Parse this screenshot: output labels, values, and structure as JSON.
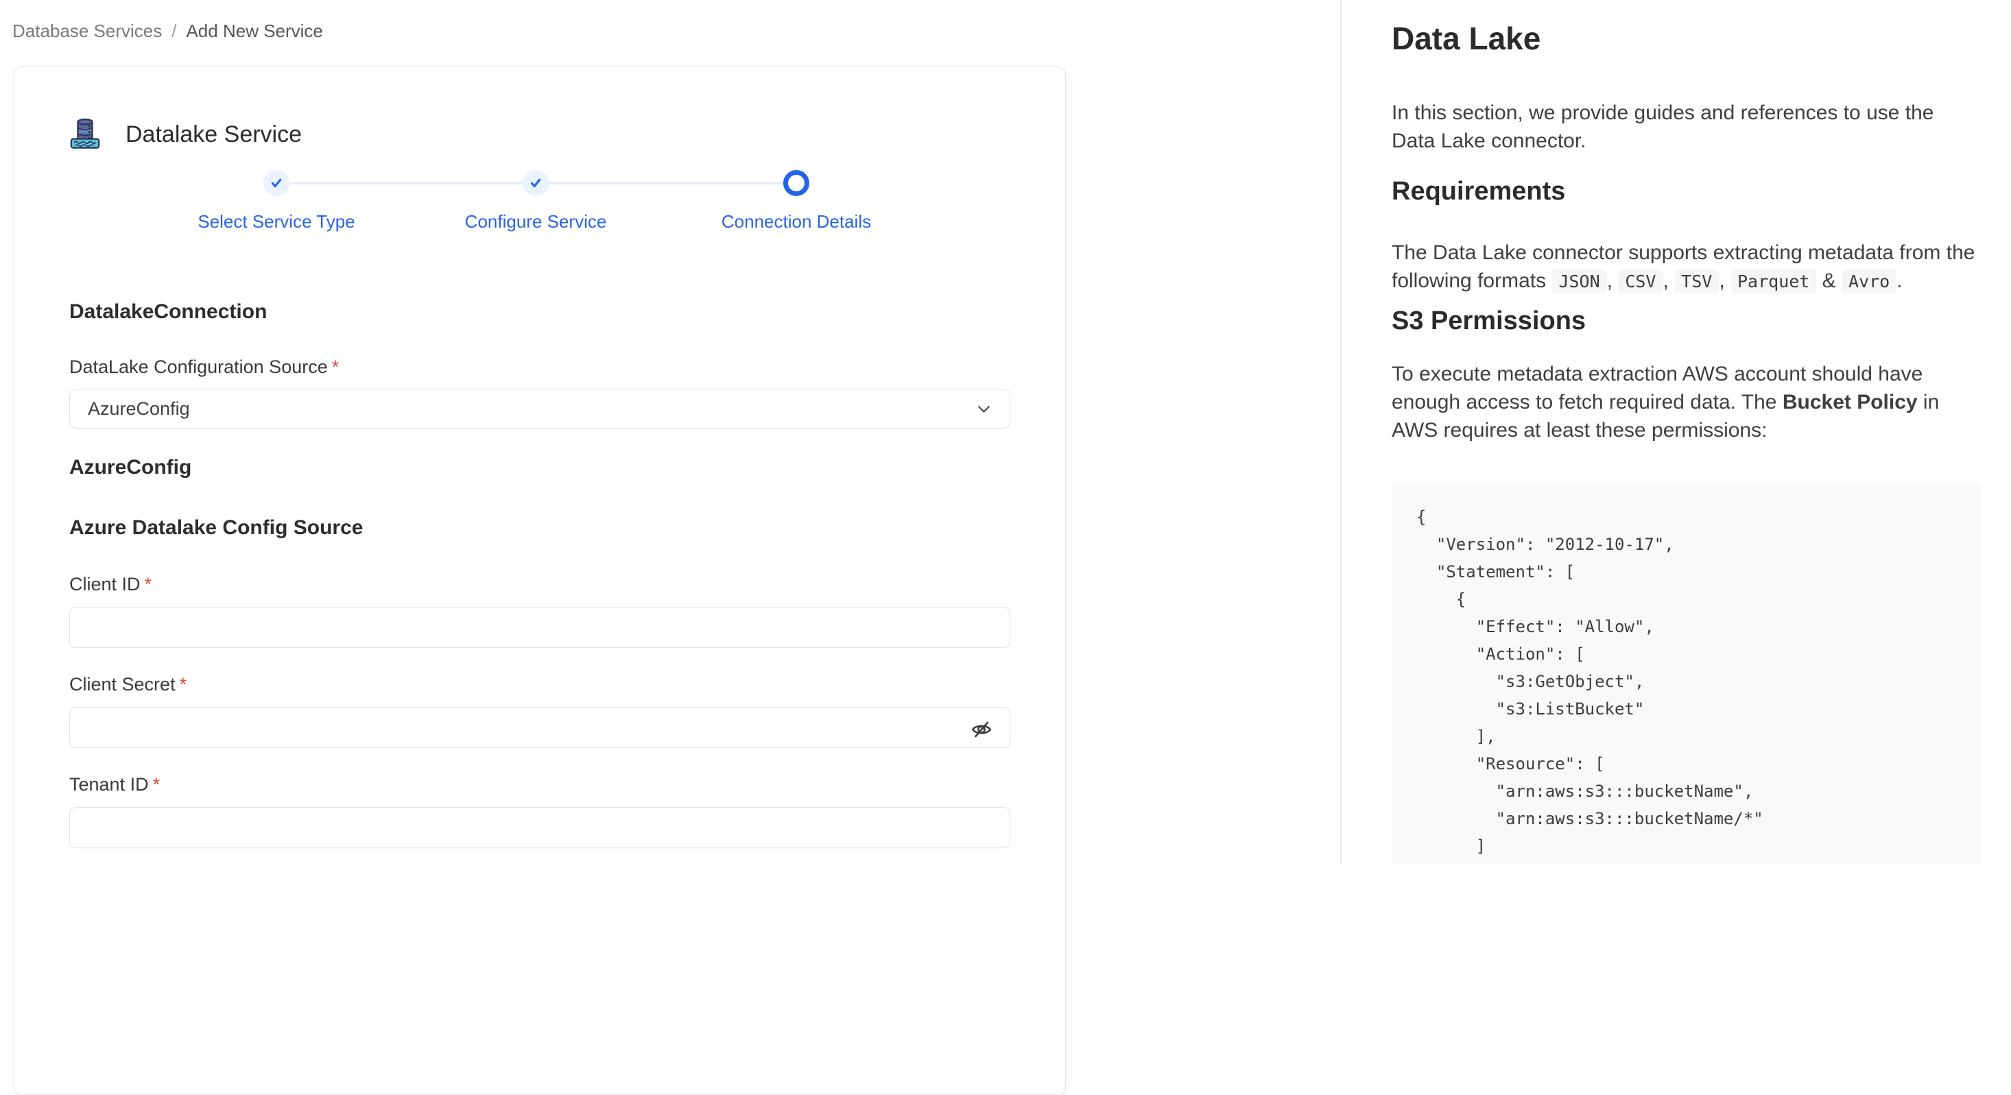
{
  "colors": {
    "accent_blue": "#2b64e4",
    "required_red": "#e8473c",
    "step_done_bg": "#e9f2fd",
    "code_bg": "#f8f9fa"
  },
  "breadcrumb": {
    "parent": "Database Services",
    "separator": "/",
    "current": "Add New Service"
  },
  "service": {
    "title": "Datalake Service",
    "icon": "datalake-icon"
  },
  "stepper": {
    "steps": [
      {
        "label": "Select Service Type",
        "state": "done"
      },
      {
        "label": "Configure Service",
        "state": "done"
      },
      {
        "label": "Connection Details",
        "state": "active"
      }
    ]
  },
  "form": {
    "section_title": "DatalakeConnection",
    "required_marker": "*",
    "config_source": {
      "label": "DataLake Configuration Source",
      "value": "AzureConfig"
    },
    "subsection_title": "AzureConfig",
    "subsection_heading": "Azure Datalake Config Source",
    "client_id": {
      "label": "Client ID",
      "value": ""
    },
    "client_secret": {
      "label": "Client Secret",
      "value": ""
    },
    "tenant_id": {
      "label": "Tenant ID",
      "value": ""
    }
  },
  "docs": {
    "title": "Data Lake",
    "intro": "In this section, we provide guides and references to use the Data Lake connector.",
    "requirements_heading": "Requirements",
    "formats_prefix": "The Data Lake connector supports extracting metadata from the following formats ",
    "formats": [
      {
        "code": "JSON",
        "sep": ", "
      },
      {
        "code": "CSV",
        "sep": ", "
      },
      {
        "code": "TSV",
        "sep": ", "
      },
      {
        "code": "Parquet",
        "sep": " & "
      },
      {
        "code": "Avro",
        "sep": "."
      }
    ],
    "s3_heading": "S3 Permissions",
    "s3_para": {
      "part1": "To execute metadata extraction AWS account should have enough access to fetch required data. The ",
      "bold": "Bucket Policy",
      "part2": " in AWS requires at least these permissions:"
    },
    "code": "{\n  \"Version\": \"2012-10-17\",\n  \"Statement\": [\n    {\n      \"Effect\": \"Allow\",\n      \"Action\": [\n        \"s3:GetObject\",\n        \"s3:ListBucket\"\n      ],\n      \"Resource\": [\n        \"arn:aws:s3:::bucketName\",\n        \"arn:aws:s3:::bucketName/*\"\n      ]"
  }
}
